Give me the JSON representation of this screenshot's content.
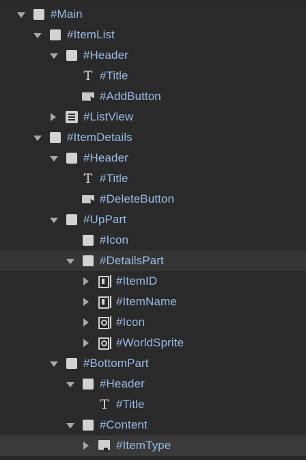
{
  "hierarchy": {
    "rows": [
      {
        "label": "#Main"
      },
      {
        "label": "#ItemList"
      },
      {
        "label": "#Header"
      },
      {
        "label": "#Title"
      },
      {
        "label": "#AddButton"
      },
      {
        "label": "#ListView"
      },
      {
        "label": "#ItemDetails"
      },
      {
        "label": "#Header"
      },
      {
        "label": "#Title"
      },
      {
        "label": "#DeleteButton"
      },
      {
        "label": "#UpPart"
      },
      {
        "label": "#Icon"
      },
      {
        "label": "#DetailsPart"
      },
      {
        "label": "#ItemID"
      },
      {
        "label": "#ItemName"
      },
      {
        "label": "#Icon"
      },
      {
        "label": "#WorldSprite"
      },
      {
        "label": "#BottomPart"
      },
      {
        "label": "#Header"
      },
      {
        "label": "#Title"
      },
      {
        "label": "#Content"
      },
      {
        "label": "#ItemType"
      }
    ]
  },
  "colors": {
    "background": "#282828",
    "label": "#9bbce8",
    "icon": "#d0d0d0",
    "selected_row": "#353535",
    "hovered_row": "#3a3a3a"
  },
  "icons": {
    "visual_element": "visual-element-icon",
    "label": "label-icon",
    "button": "button-icon",
    "list_view": "list-view-icon",
    "text_field": "text-field-icon",
    "object_field": "object-field-icon",
    "dropdown_field": "dropdown-field-icon"
  }
}
